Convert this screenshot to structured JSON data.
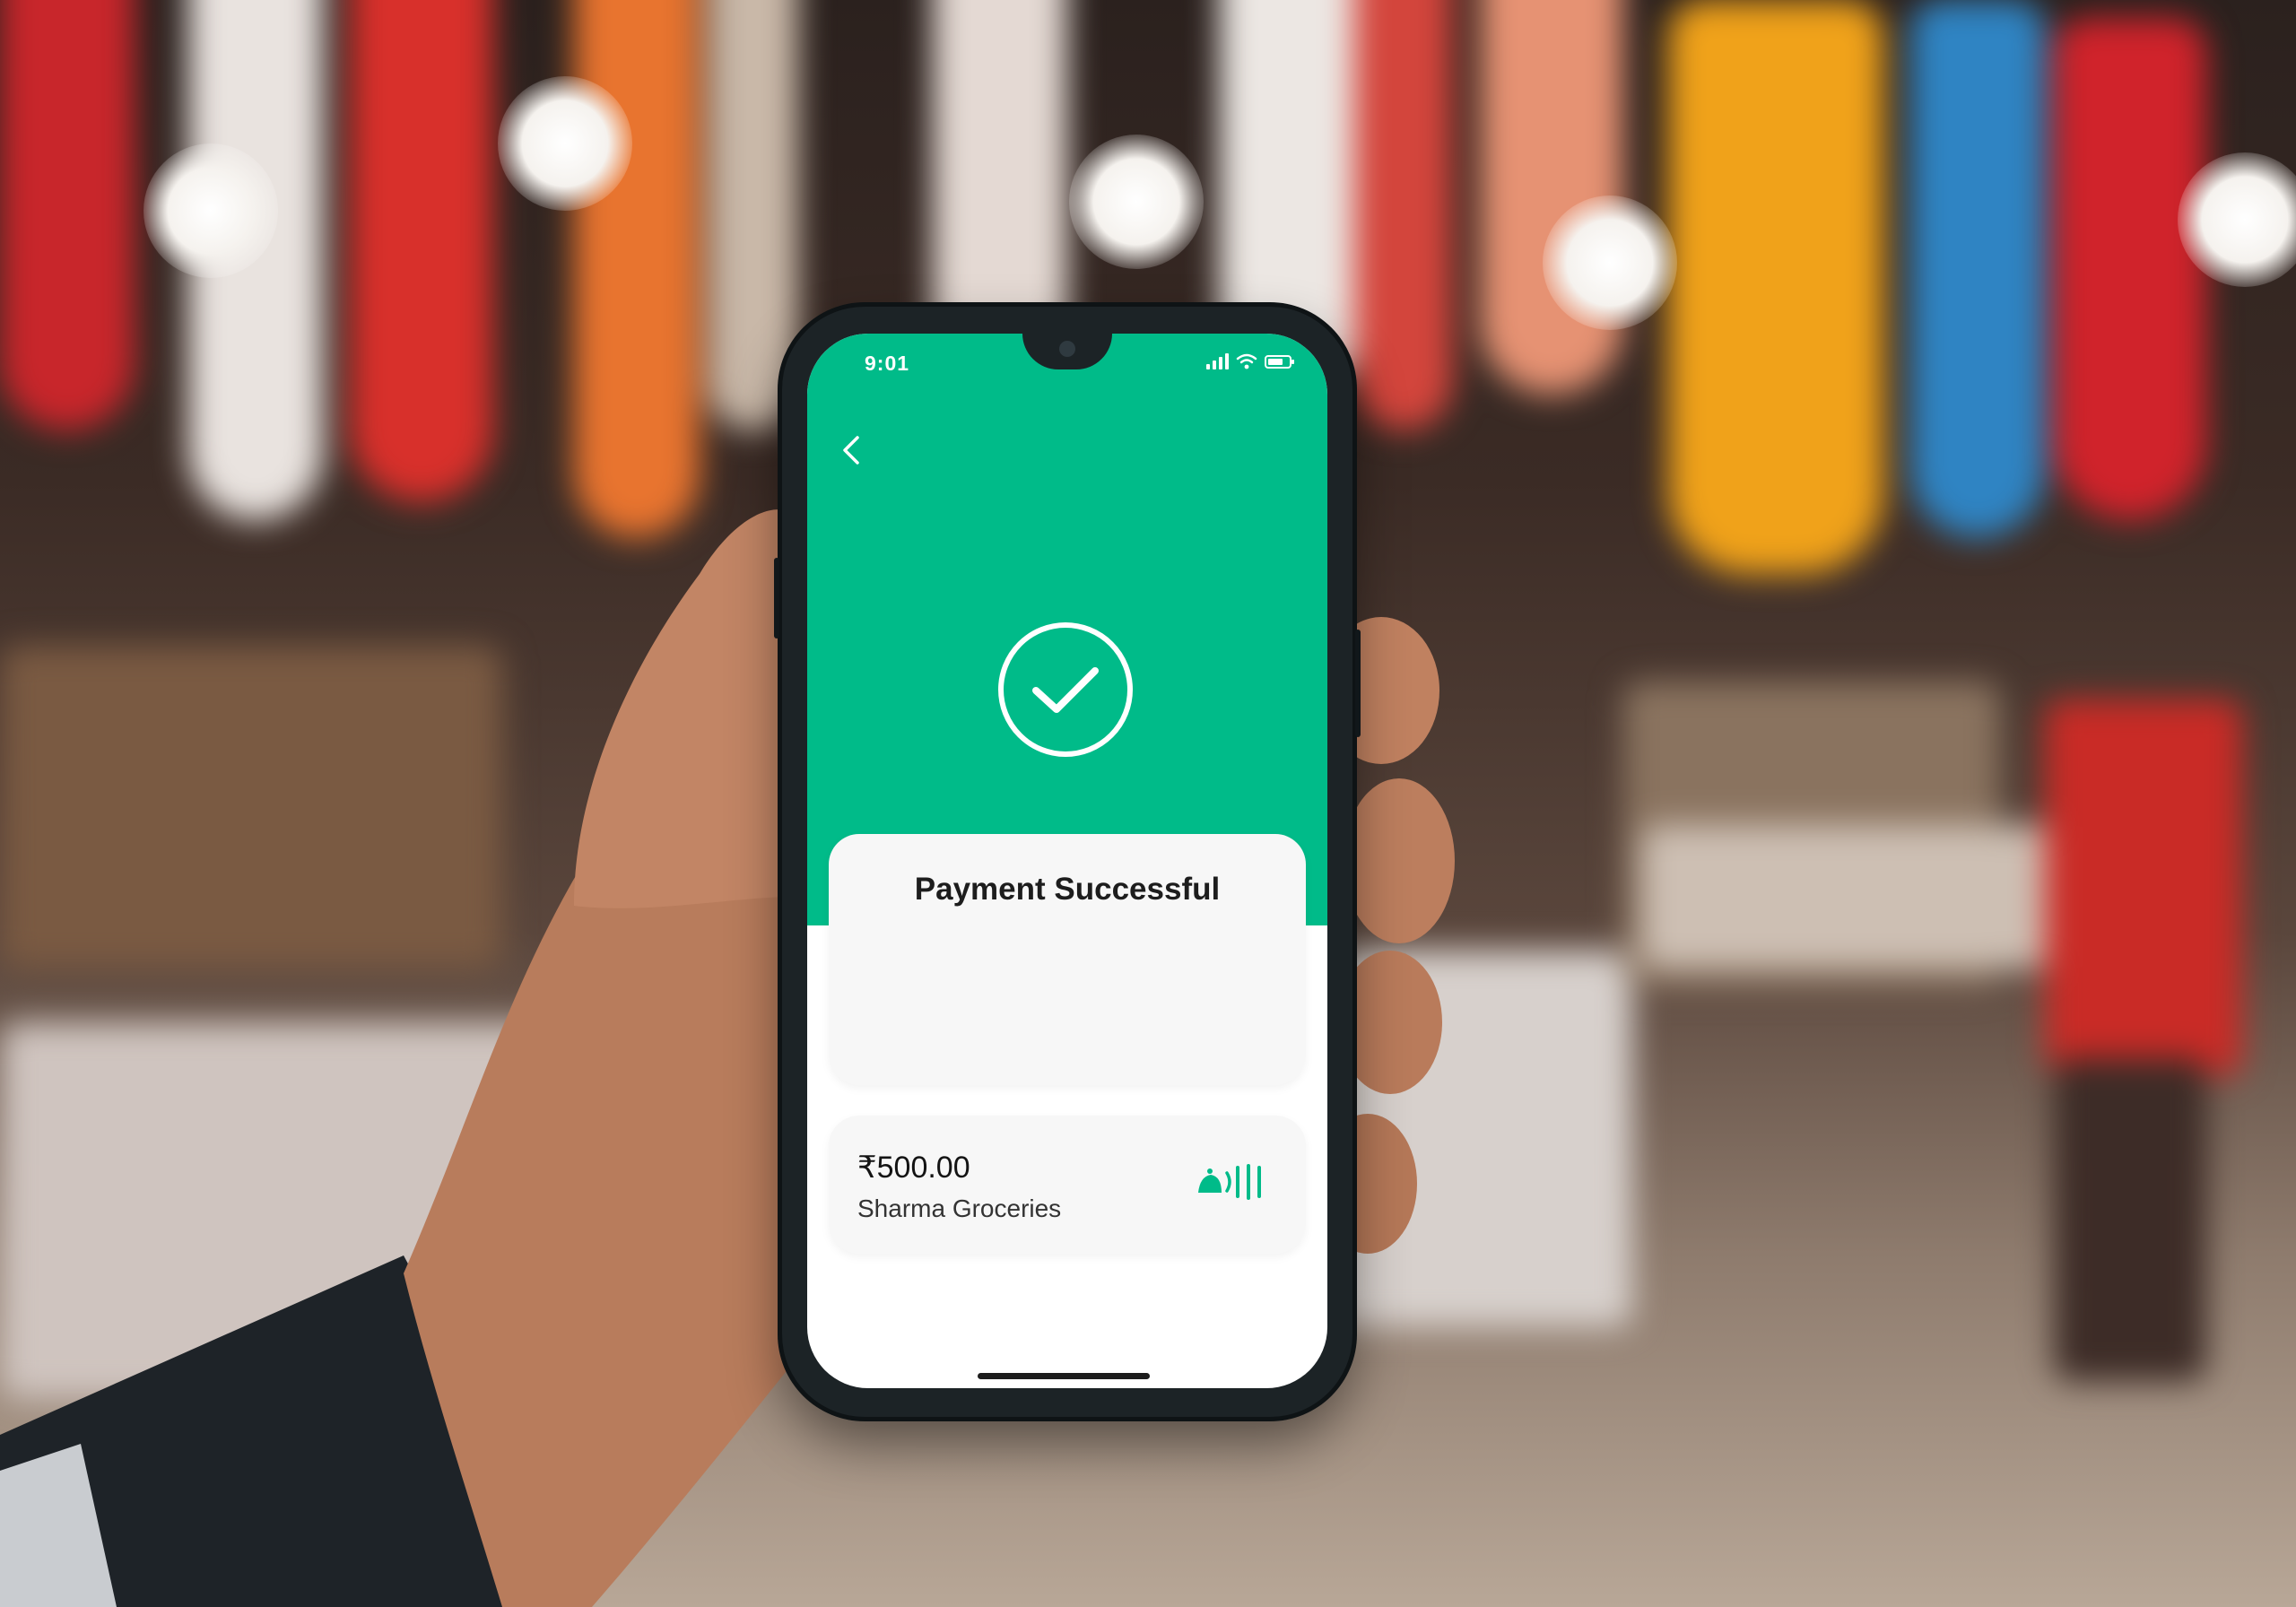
{
  "status_bar": {
    "time": "9:01"
  },
  "screen": {
    "title": "Payment Successful",
    "amount": "₹500.00",
    "merchant": "Sharma Groceries"
  },
  "colors": {
    "accent": "#00bb89",
    "card": "#f7f7f7",
    "text": "#1d1d1d"
  },
  "icons": [
    "back-chevron-icon",
    "checkmark-circle-icon",
    "signal-icon",
    "wifi-icon",
    "battery-icon",
    "contactless-pay-icon"
  ]
}
